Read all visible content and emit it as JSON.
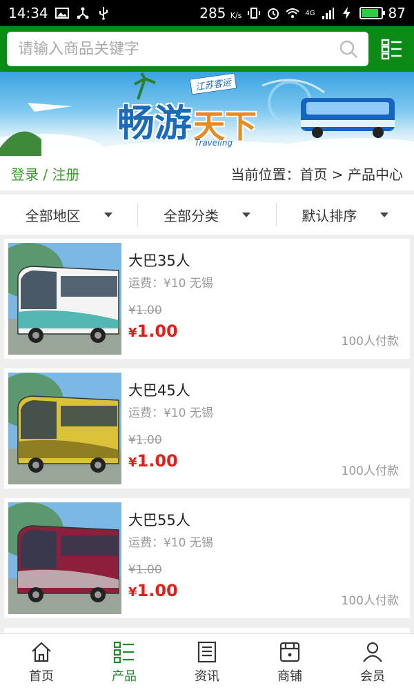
{
  "status_bar": {
    "time": "14:34",
    "speed": "285",
    "speed_unit": "K/s",
    "network": "4G",
    "battery": "87",
    "battery_level": 0.87
  },
  "search": {
    "placeholder": "请输入商品关键字"
  },
  "banner": {
    "title_part1": "畅游",
    "title_part2": "天下",
    "subtitle": "Traveling",
    "tag": "江苏客运"
  },
  "breadcrumb": {
    "login": "登录 / 注册",
    "position": "当前位置：首页 > 产品中心"
  },
  "filters": [
    {
      "label": "全部地区"
    },
    {
      "label": "全部分类"
    },
    {
      "label": "默认排序"
    }
  ],
  "products": [
    {
      "name": "大巴35人",
      "shipping": "运费：¥10 无锡",
      "old_price": "¥1.00",
      "currency": "¥",
      "price": "1.00",
      "sold": "100人付款",
      "body_color": "#f4f4f4",
      "accent": "#2aa9a2"
    },
    {
      "name": "大巴45人",
      "shipping": "运费：¥10 无锡",
      "old_price": "¥1.00",
      "currency": "¥",
      "price": "1.00",
      "sold": "100人付款",
      "body_color": "#d9c23a",
      "accent": "#7a6d1c"
    },
    {
      "name": "大巴55人",
      "shipping": "运费：¥10 无锡",
      "old_price": "¥1.00",
      "currency": "¥",
      "price": "1.00",
      "sold": "100人付款",
      "body_color": "#8c1f3c",
      "accent": "#c9c9c9"
    }
  ],
  "tabs": [
    {
      "label": "首页",
      "icon": "home-icon"
    },
    {
      "label": "产品",
      "icon": "list-icon",
      "active": true
    },
    {
      "label": "资讯",
      "icon": "news-icon"
    },
    {
      "label": "商铺",
      "icon": "shop-icon"
    },
    {
      "label": "会员",
      "icon": "user-icon"
    }
  ],
  "colors": {
    "brand_green": "#0b8a16",
    "price_red": "#e0201a",
    "login_green": "#3a9a2c"
  }
}
